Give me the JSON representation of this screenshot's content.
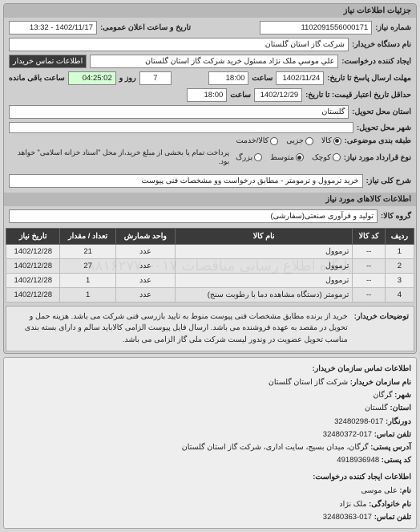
{
  "panel_title": "جزئیات اطلاعات نیاز",
  "labels": {
    "req_no": "شماره نیاز:",
    "datetime_public": "تاریخ و ساعت اعلان عمومی:",
    "buyer_device": "نام دستگاه خریدار:",
    "request_creator": "ایجاد کننده درخواست:",
    "send_deadline": "مهلت ارسال پاسخ تا تاریخ:",
    "time": "ساعت",
    "day": "روز و",
    "remaining": "ساعت باقی مانده",
    "price_deadline": "حداقل تاریخ اعتبار قیمت: تا تاریخ:",
    "delivery_state": "استان محل تحویل:",
    "delivery_city": "شهر محل تحویل:",
    "catalog": "طبقه بندی موضوعی:",
    "agreement_type": "نوع قرارداد مورد نیاز:",
    "main_title": "شرح کلی نیاز:",
    "goods_info": "اطلاعات کالاهای مورد نیاز",
    "goods_group": "گروه کالا:",
    "buyer_notes": "توضیحات خریدار:",
    "contact_buyer_link": "اطلاعات تماس خریدار"
  },
  "values": {
    "req_no": "1102091556000171",
    "public_date": "1402/11/17 - 13:32",
    "buyer_device": "شرکت گاز استان گلستان",
    "request_creator": "علي موسي ملک نژاد مسئول خرید شرکت گاز استان گلستان",
    "send_deadline_date": "1402/11/24",
    "send_deadline_time": "18:00",
    "days_remain": "7",
    "hours_remain": "04:25:02",
    "price_deadline_date": "1402/12/29",
    "price_deadline_time": "18:00",
    "delivery_state": "گلستان",
    "delivery_city": "",
    "main_title": "خرید ترموول و ترمومتر - مطابق درخواست وو مشخصات فنی پیوست",
    "goods_group": "تولید و فرآوری صنعتی(سفارشی)",
    "buyer_notes": "خرید از برنده مطابق مشخصات فنی پیوست منوط به تایید بازرسی فنی شرکت می باشد. هزینه حمل و تحویل در مقصد به عهده فروشنده می باشد. ارسال فایل پیوست الزامی کالاباید سالم و دارای بسته بندی مناسب تحویل عضویت در وندور لیست شرکت ملی گاز الزامی می باشد."
  },
  "catalog_options": {
    "goods": "کالا",
    "service": "جزیی",
    "both": "کالا/خدمت"
  },
  "agreement_options": {
    "small": "کوچک",
    "medium": "متوسط",
    "large": "بزرگ"
  },
  "agreement_note": "پرداخت تمام یا بخشی از مبلغ خرید،از محل \"اسناد خزانه اسلامی\" خواهد بود.",
  "table": {
    "headers": {
      "row": "ردیف",
      "code": "کد کالا",
      "name": "نام کالا",
      "unit": "واحد شمارش",
      "qty": "تعداد / مقدار",
      "date": "تاریخ نیاز"
    },
    "rows": [
      {
        "row": "1",
        "code": "--",
        "name": "ترموول",
        "unit": "عدد",
        "qty": "21",
        "date": "1402/12/28"
      },
      {
        "row": "2",
        "code": "--",
        "name": "ترموول",
        "unit": "عدد",
        "qty": "27",
        "date": "1402/12/28"
      },
      {
        "row": "3",
        "code": "--",
        "name": "ترموول",
        "unit": "عدد",
        "qty": "1",
        "date": "1402/12/28"
      },
      {
        "row": "4",
        "code": "--",
        "name": "ترمومتر (دستگاه مشاهده دما با رطوبت سنج)",
        "unit": "عدد",
        "qty": "1",
        "date": "1402/12/28"
      }
    ]
  },
  "contact": {
    "header1": "اطلاعات تماس سازمان خریدار:",
    "org_name_label": "نام سازمان خریدار:",
    "org_name": "شرکت گاز استان گلستان",
    "city_label": "شهر:",
    "city": "گرگان",
    "state_label": "استان:",
    "state": "گلستان",
    "prefix_label": "دورنگار:",
    "prefix": "017-32480298",
    "phone_label": "تلفن تماس:",
    "phone": "017-32480372",
    "postal_label": "آدرس پستی:",
    "postal": "گرگان، میدان بسیج، سایت اداری، شرکت گاز استان گلستان",
    "postcode_label": "کد پستی:",
    "postcode": "4918936948",
    "header2": "اطلاعات ایجاد کننده درخواست:",
    "fname_label": "نام:",
    "fname": "علی موسی",
    "lname_label": "نام خانوادگی:",
    "lname": "ملک نژاد",
    "phone2_label": "تلفن تماس:",
    "phone2": "017-32480363"
  },
  "watermark": "پایگاه اطلاع رسانی مناقصات ۰۱۷-۸۸۱۶۲۷۷۰"
}
